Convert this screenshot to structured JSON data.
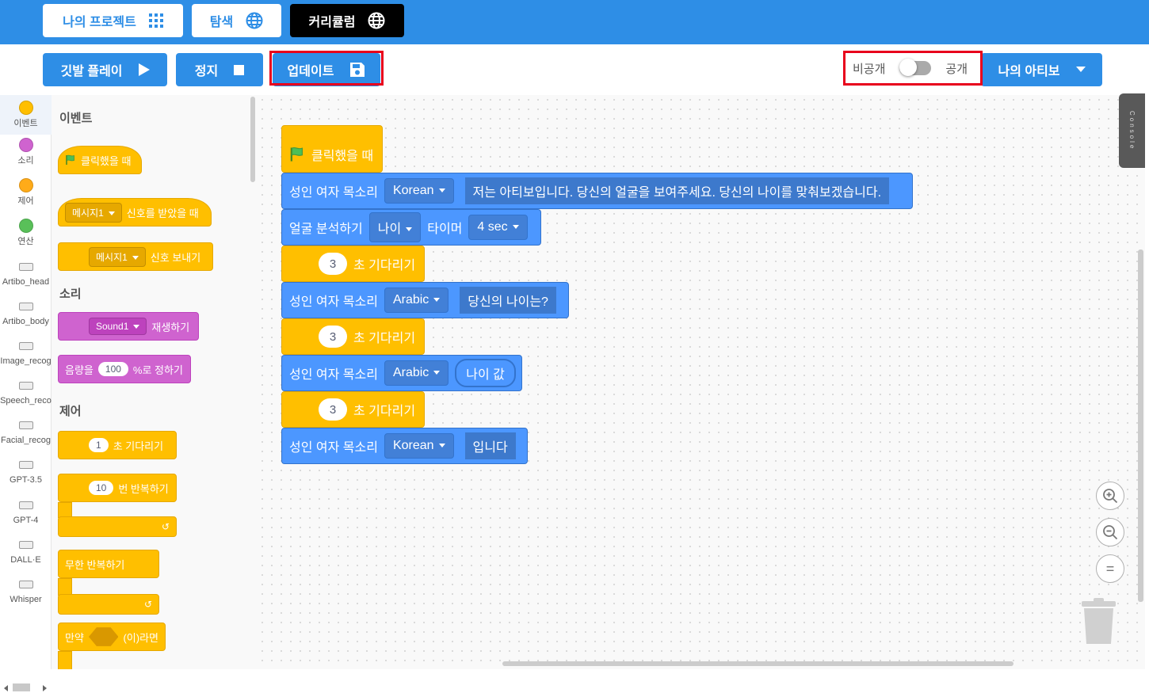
{
  "nav": {
    "my_projects": "나의 프로젝트",
    "explore": "탐색",
    "curriculum": "커리큘럼"
  },
  "toolbar": {
    "flag_play": "깃발 플레이",
    "stop": "정지",
    "update": "업데이트",
    "private": "비공개",
    "public": "공개",
    "my_artibo": "나의 아티보"
  },
  "categories": [
    {
      "label": "이벤트",
      "color": "#ffbf00"
    },
    {
      "label": "소리",
      "color": "#cf63cf"
    },
    {
      "label": "제어",
      "color": "#ffab19"
    },
    {
      "label": "연산",
      "color": "#59c059"
    },
    {
      "label": "Artibo_head"
    },
    {
      "label": "Artibo_body"
    },
    {
      "label": "Image_recog"
    },
    {
      "label": "Speech_reco"
    },
    {
      "label": "Facial_recog"
    },
    {
      "label": "GPT-3.5"
    },
    {
      "label": "GPT-4"
    },
    {
      "label": "DALL·E"
    },
    {
      "label": "Whisper"
    }
  ],
  "palette": {
    "events_title": "이벤트",
    "when_clicked": "클릭했을 때",
    "message1": "메시지1",
    "when_receive": "신호를 받았을 때",
    "broadcast": "신호 보내기",
    "sound_title": "소리",
    "sound1": "Sound1",
    "play": "재생하기",
    "volume_prefix": "음량을",
    "volume_value": "100",
    "volume_suffix": "%로 정하기",
    "control_title": "제어",
    "wait_value": "1",
    "wait_label": "초 기다리기",
    "repeat_value": "10",
    "repeat_label": "번 반복하기",
    "forever": "무한 반복하기",
    "if_label": "만약",
    "then_label": "(이)라면"
  },
  "script": {
    "hat": "클릭했을 때",
    "voice_label": "성인 여자 목소리",
    "lang_korean": "Korean",
    "lang_arabic": "Arabic",
    "speech1": "저는 아티보입니다. 당신의 얼굴을 보여주세요. 당신의 나이를 맞춰보겠습니다.",
    "analyze": "얼굴 분석하기",
    "age": "나이",
    "timer": "타이머",
    "timer_value": "4 sec",
    "wait_num": "3",
    "wait_label": "초 기다리기",
    "speech2": "당신의 나이는?",
    "age_value": "나이 값",
    "speech3": "입니다"
  },
  "console_label": "Console",
  "zoom": {
    "reset": "="
  }
}
